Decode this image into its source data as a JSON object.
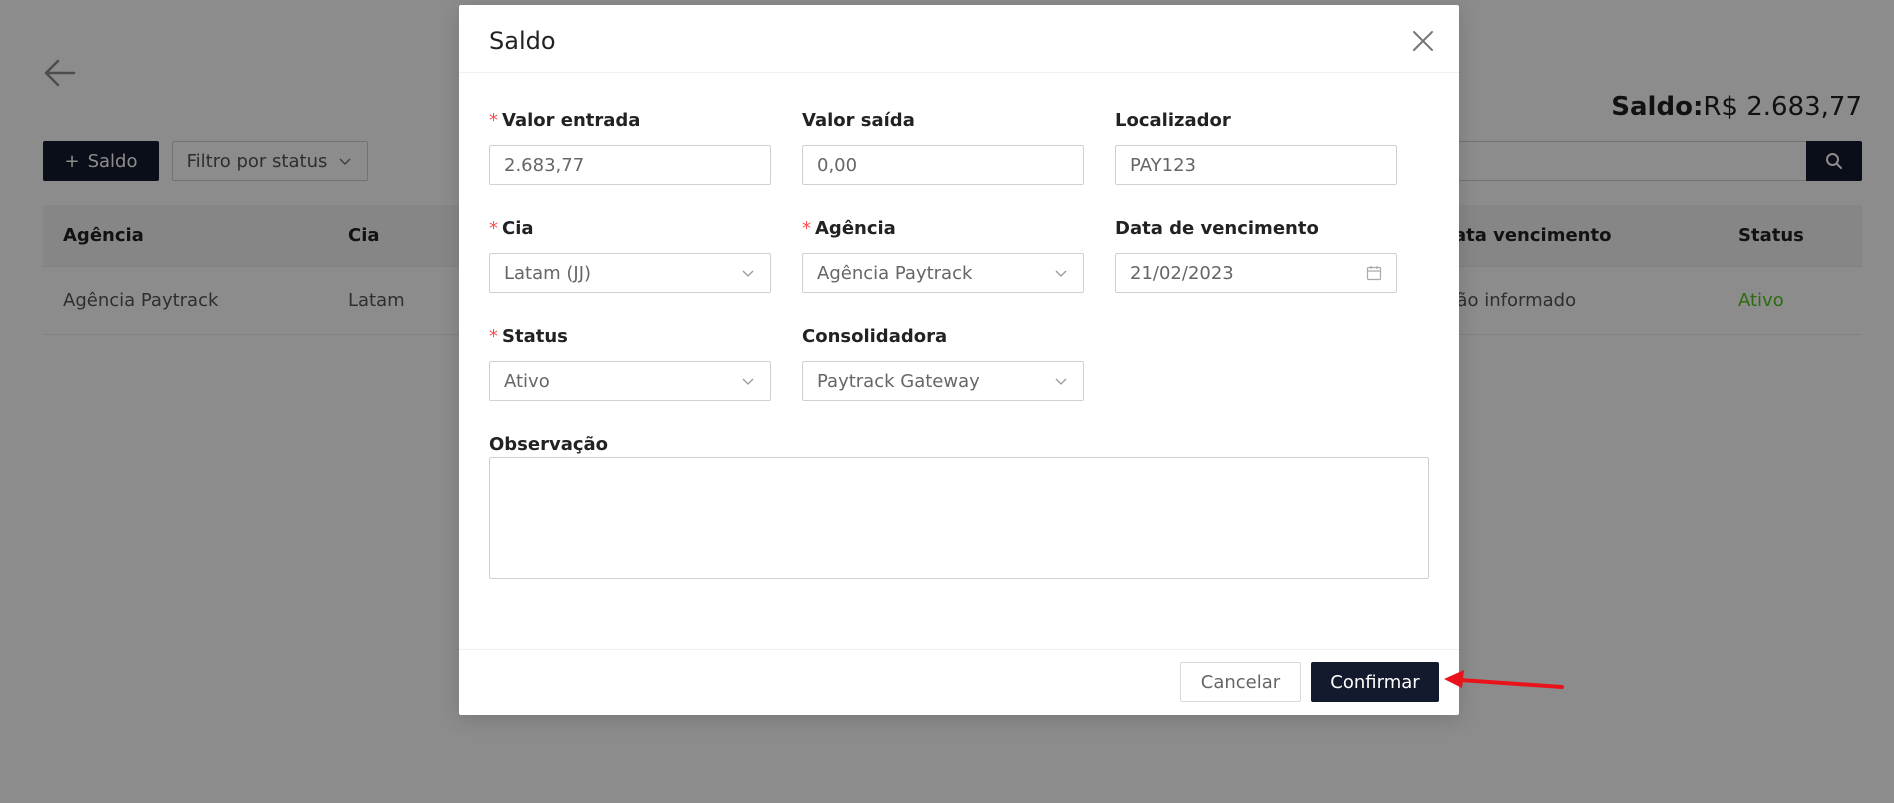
{
  "background": {
    "balance_label": "Saldo:",
    "balance_value": "R$ 2.683,77",
    "add_button": "Saldo",
    "filter_button": "Filtro por status",
    "table": {
      "columns": [
        "Agência",
        "Cia",
        "Data vencimento",
        "Status"
      ],
      "rows": [
        {
          "agencia": "Agência Paytrack",
          "cia": "Latam",
          "vencimento": "Não informado",
          "status": "Ativo"
        }
      ]
    }
  },
  "modal": {
    "title": "Saldo",
    "fields": {
      "valor_entrada": {
        "label": "Valor entrada",
        "required": true,
        "value": "2.683,77"
      },
      "valor_saida": {
        "label": "Valor saída",
        "required": false,
        "value": "0,00"
      },
      "localizador": {
        "label": "Localizador",
        "required": false,
        "value": "PAY123"
      },
      "cia": {
        "label": "Cia",
        "required": true,
        "value": "Latam (JJ)"
      },
      "agencia": {
        "label": "Agência",
        "required": true,
        "value": "Agência Paytrack"
      },
      "data_vencimento": {
        "label": "Data de vencimento",
        "required": false,
        "value": "21/02/2023"
      },
      "status": {
        "label": "Status",
        "required": true,
        "value": "Ativo"
      },
      "consolidadora": {
        "label": "Consolidadora",
        "required": false,
        "value": "Paytrack Gateway"
      },
      "observacao": {
        "label": "Observação",
        "required": false,
        "value": ""
      }
    },
    "cancel_label": "Cancelar",
    "confirm_label": "Confirmar"
  },
  "colors": {
    "primary": "#131a2e",
    "required_marker": "#ff4d4f",
    "status_active": "#52c41a",
    "annotation_arrow": "#e8131b"
  }
}
